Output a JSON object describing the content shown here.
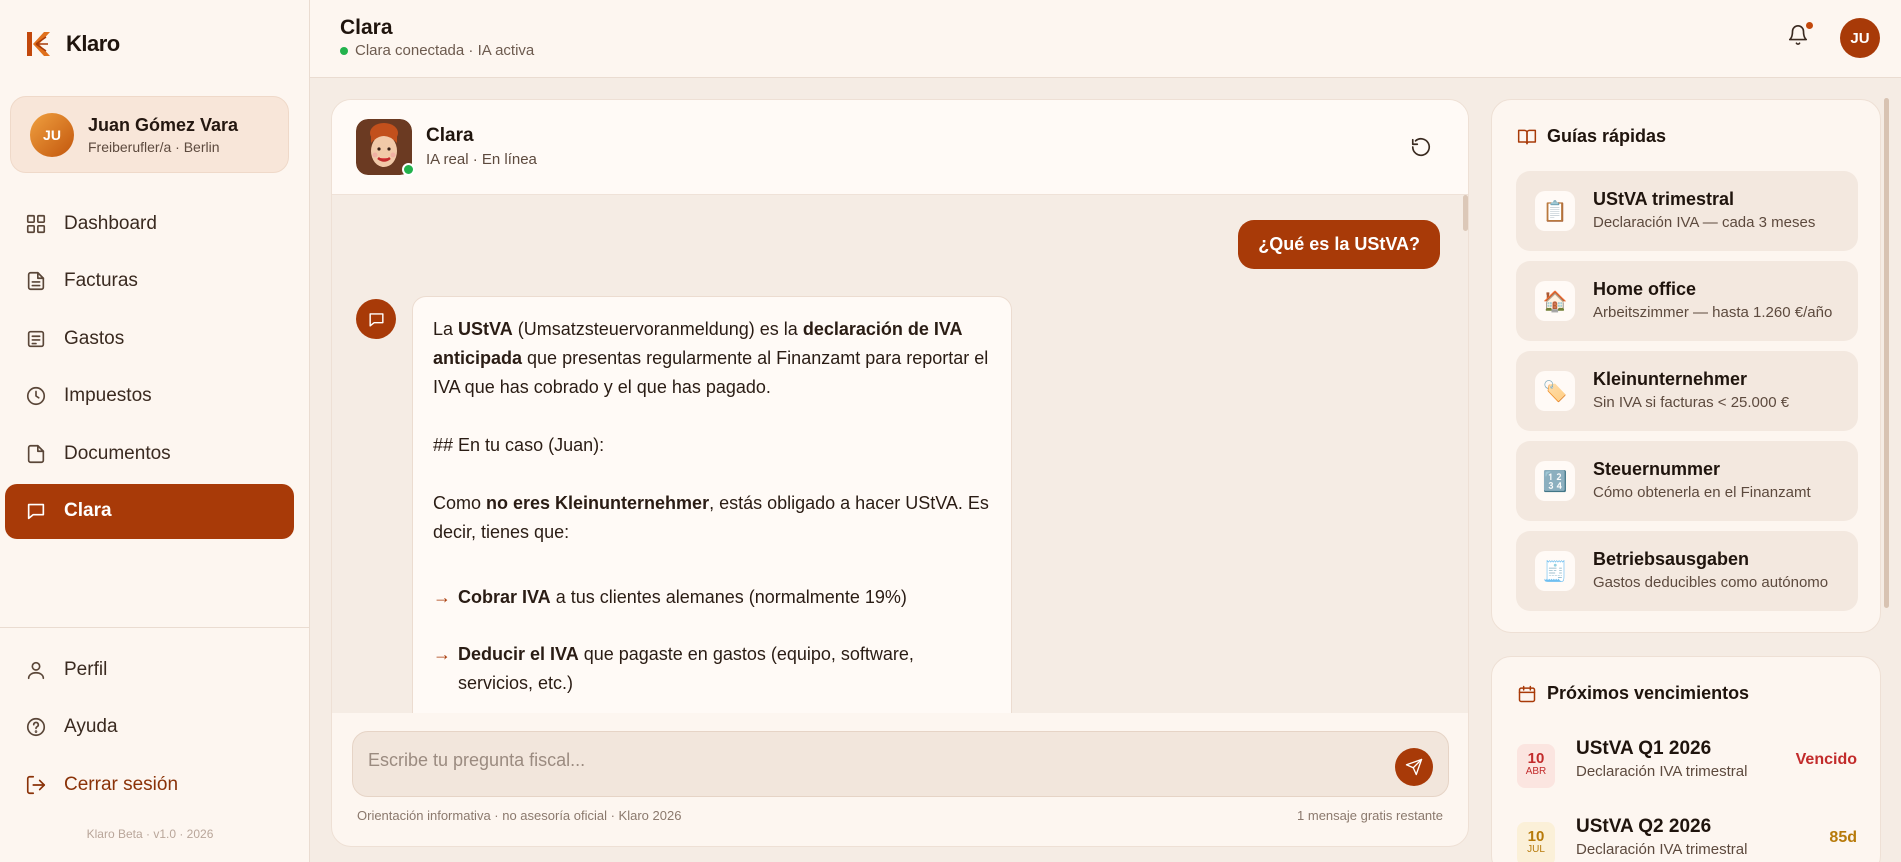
{
  "brand": {
    "name": "Klaro"
  },
  "user": {
    "initials": "JU",
    "name": "Juan Gómez Vara",
    "subtitle": "Freiberufler/a · Berlin"
  },
  "nav": {
    "dashboard": "Dashboard",
    "facturas": "Facturas",
    "gastos": "Gastos",
    "impuestos": "Impuestos",
    "documentos": "Documentos",
    "clara": "Clara"
  },
  "nav_bottom": {
    "perfil": "Perfil",
    "ayuda": "Ayuda",
    "logout": "Cerrar sesión"
  },
  "version": "Klaro Beta · v1.0 · 2026",
  "header": {
    "title": "Clara",
    "status": "Clara conectada · IA activa",
    "avatar_initials": "JU"
  },
  "chat": {
    "name": "Clara",
    "subtitle": "IA real · En línea",
    "user_message": "¿Qué es la UStVA?",
    "bot": {
      "p1_a": "La ",
      "p1_b": "UStVA",
      "p1_c": " (Umsatzsteuervoranmeldung) es la ",
      "p1_d": "declaración de IVA anticipada",
      "p1_e": " que presentas regularmente al Finanzamt para reportar el IVA que has cobrado y el que has pagado.",
      "p2": "## En tu caso (Juan):",
      "p3_a": "Como ",
      "p3_b": "no eres Kleinunternehmer",
      "p3_c": ", estás obligado a hacer UStVA. Es decir, tienes que:",
      "arrow": "→",
      "b1_a": "Cobrar IVA",
      "b1_b": " a tus clientes alemanes (normalmente 19%)",
      "b2_a": "Deducir el IVA",
      "b2_b": " que pagaste en gastos (equipo, software, servicios, etc.)"
    },
    "input_placeholder": "Escribe tu pregunta fiscal...",
    "footer_left": "Orientación informativa · no asesoría oficial · Klaro 2026",
    "footer_right": "1 mensaje gratis restante"
  },
  "guides": {
    "title": "Guías rápidas",
    "items": [
      {
        "icon": "📋",
        "icon_name": "clipboard-icon",
        "title": "UStVA trimestral",
        "subtitle": "Declaración IVA — cada 3 meses"
      },
      {
        "icon": "🏠",
        "icon_name": "house-icon",
        "title": "Home office",
        "subtitle": "Arbeitszimmer — hasta 1.260 €/año"
      },
      {
        "icon": "🏷️",
        "icon_name": "tag-icon",
        "title": "Kleinunternehmer",
        "subtitle": "Sin IVA si facturas < 25.000 €"
      },
      {
        "icon": "🔢",
        "icon_name": "numbers-icon",
        "title": "Steuernummer",
        "subtitle": "Cómo obtenerla en el Finanzamt"
      },
      {
        "icon": "🧾",
        "icon_name": "receipt-icon",
        "title": "Betriebsausgaben",
        "subtitle": "Gastos deducibles como autónomo"
      }
    ]
  },
  "deadlines": {
    "title": "Próximos vencimientos",
    "items": [
      {
        "day": "10",
        "month": "ABR",
        "title": "UStVA Q1 2026",
        "subtitle": "Declaración IVA trimestral",
        "status": "Vencido"
      },
      {
        "day": "10",
        "month": "JUL",
        "title": "UStVA Q2 2026",
        "subtitle": "Declaración IVA trimestral",
        "status": "85d"
      }
    ]
  },
  "colors": {
    "accent": "#a83a08",
    "online": "#22b24c",
    "overdue": "#c22b2b",
    "upcoming": "#b77a0a"
  }
}
